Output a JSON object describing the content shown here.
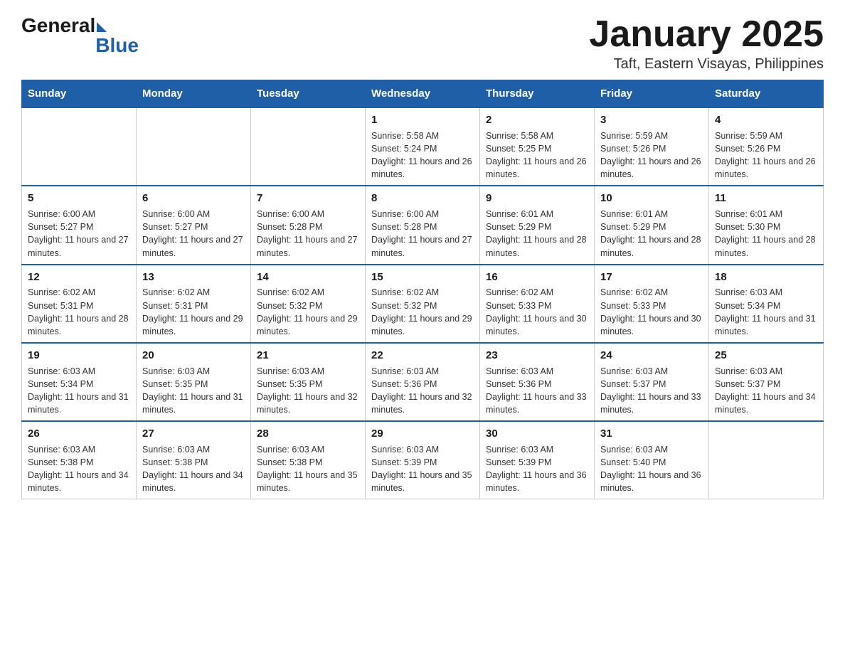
{
  "header": {
    "logo": {
      "general": "General",
      "blue": "Blue"
    },
    "title": "January 2025",
    "location": "Taft, Eastern Visayas, Philippines"
  },
  "days_of_week": [
    "Sunday",
    "Monday",
    "Tuesday",
    "Wednesday",
    "Thursday",
    "Friday",
    "Saturday"
  ],
  "weeks": [
    [
      {
        "day": "",
        "sunrise": "",
        "sunset": "",
        "daylight": ""
      },
      {
        "day": "",
        "sunrise": "",
        "sunset": "",
        "daylight": ""
      },
      {
        "day": "",
        "sunrise": "",
        "sunset": "",
        "daylight": ""
      },
      {
        "day": "1",
        "sunrise": "Sunrise: 5:58 AM",
        "sunset": "Sunset: 5:24 PM",
        "daylight": "Daylight: 11 hours and 26 minutes."
      },
      {
        "day": "2",
        "sunrise": "Sunrise: 5:58 AM",
        "sunset": "Sunset: 5:25 PM",
        "daylight": "Daylight: 11 hours and 26 minutes."
      },
      {
        "day": "3",
        "sunrise": "Sunrise: 5:59 AM",
        "sunset": "Sunset: 5:26 PM",
        "daylight": "Daylight: 11 hours and 26 minutes."
      },
      {
        "day": "4",
        "sunrise": "Sunrise: 5:59 AM",
        "sunset": "Sunset: 5:26 PM",
        "daylight": "Daylight: 11 hours and 26 minutes."
      }
    ],
    [
      {
        "day": "5",
        "sunrise": "Sunrise: 6:00 AM",
        "sunset": "Sunset: 5:27 PM",
        "daylight": "Daylight: 11 hours and 27 minutes."
      },
      {
        "day": "6",
        "sunrise": "Sunrise: 6:00 AM",
        "sunset": "Sunset: 5:27 PM",
        "daylight": "Daylight: 11 hours and 27 minutes."
      },
      {
        "day": "7",
        "sunrise": "Sunrise: 6:00 AM",
        "sunset": "Sunset: 5:28 PM",
        "daylight": "Daylight: 11 hours and 27 minutes."
      },
      {
        "day": "8",
        "sunrise": "Sunrise: 6:00 AM",
        "sunset": "Sunset: 5:28 PM",
        "daylight": "Daylight: 11 hours and 27 minutes."
      },
      {
        "day": "9",
        "sunrise": "Sunrise: 6:01 AM",
        "sunset": "Sunset: 5:29 PM",
        "daylight": "Daylight: 11 hours and 28 minutes."
      },
      {
        "day": "10",
        "sunrise": "Sunrise: 6:01 AM",
        "sunset": "Sunset: 5:29 PM",
        "daylight": "Daylight: 11 hours and 28 minutes."
      },
      {
        "day": "11",
        "sunrise": "Sunrise: 6:01 AM",
        "sunset": "Sunset: 5:30 PM",
        "daylight": "Daylight: 11 hours and 28 minutes."
      }
    ],
    [
      {
        "day": "12",
        "sunrise": "Sunrise: 6:02 AM",
        "sunset": "Sunset: 5:31 PM",
        "daylight": "Daylight: 11 hours and 28 minutes."
      },
      {
        "day": "13",
        "sunrise": "Sunrise: 6:02 AM",
        "sunset": "Sunset: 5:31 PM",
        "daylight": "Daylight: 11 hours and 29 minutes."
      },
      {
        "day": "14",
        "sunrise": "Sunrise: 6:02 AM",
        "sunset": "Sunset: 5:32 PM",
        "daylight": "Daylight: 11 hours and 29 minutes."
      },
      {
        "day": "15",
        "sunrise": "Sunrise: 6:02 AM",
        "sunset": "Sunset: 5:32 PM",
        "daylight": "Daylight: 11 hours and 29 minutes."
      },
      {
        "day": "16",
        "sunrise": "Sunrise: 6:02 AM",
        "sunset": "Sunset: 5:33 PM",
        "daylight": "Daylight: 11 hours and 30 minutes."
      },
      {
        "day": "17",
        "sunrise": "Sunrise: 6:02 AM",
        "sunset": "Sunset: 5:33 PM",
        "daylight": "Daylight: 11 hours and 30 minutes."
      },
      {
        "day": "18",
        "sunrise": "Sunrise: 6:03 AM",
        "sunset": "Sunset: 5:34 PM",
        "daylight": "Daylight: 11 hours and 31 minutes."
      }
    ],
    [
      {
        "day": "19",
        "sunrise": "Sunrise: 6:03 AM",
        "sunset": "Sunset: 5:34 PM",
        "daylight": "Daylight: 11 hours and 31 minutes."
      },
      {
        "day": "20",
        "sunrise": "Sunrise: 6:03 AM",
        "sunset": "Sunset: 5:35 PM",
        "daylight": "Daylight: 11 hours and 31 minutes."
      },
      {
        "day": "21",
        "sunrise": "Sunrise: 6:03 AM",
        "sunset": "Sunset: 5:35 PM",
        "daylight": "Daylight: 11 hours and 32 minutes."
      },
      {
        "day": "22",
        "sunrise": "Sunrise: 6:03 AM",
        "sunset": "Sunset: 5:36 PM",
        "daylight": "Daylight: 11 hours and 32 minutes."
      },
      {
        "day": "23",
        "sunrise": "Sunrise: 6:03 AM",
        "sunset": "Sunset: 5:36 PM",
        "daylight": "Daylight: 11 hours and 33 minutes."
      },
      {
        "day": "24",
        "sunrise": "Sunrise: 6:03 AM",
        "sunset": "Sunset: 5:37 PM",
        "daylight": "Daylight: 11 hours and 33 minutes."
      },
      {
        "day": "25",
        "sunrise": "Sunrise: 6:03 AM",
        "sunset": "Sunset: 5:37 PM",
        "daylight": "Daylight: 11 hours and 34 minutes."
      }
    ],
    [
      {
        "day": "26",
        "sunrise": "Sunrise: 6:03 AM",
        "sunset": "Sunset: 5:38 PM",
        "daylight": "Daylight: 11 hours and 34 minutes."
      },
      {
        "day": "27",
        "sunrise": "Sunrise: 6:03 AM",
        "sunset": "Sunset: 5:38 PM",
        "daylight": "Daylight: 11 hours and 34 minutes."
      },
      {
        "day": "28",
        "sunrise": "Sunrise: 6:03 AM",
        "sunset": "Sunset: 5:38 PM",
        "daylight": "Daylight: 11 hours and 35 minutes."
      },
      {
        "day": "29",
        "sunrise": "Sunrise: 6:03 AM",
        "sunset": "Sunset: 5:39 PM",
        "daylight": "Daylight: 11 hours and 35 minutes."
      },
      {
        "day": "30",
        "sunrise": "Sunrise: 6:03 AM",
        "sunset": "Sunset: 5:39 PM",
        "daylight": "Daylight: 11 hours and 36 minutes."
      },
      {
        "day": "31",
        "sunrise": "Sunrise: 6:03 AM",
        "sunset": "Sunset: 5:40 PM",
        "daylight": "Daylight: 11 hours and 36 minutes."
      },
      {
        "day": "",
        "sunrise": "",
        "sunset": "",
        "daylight": ""
      }
    ]
  ]
}
